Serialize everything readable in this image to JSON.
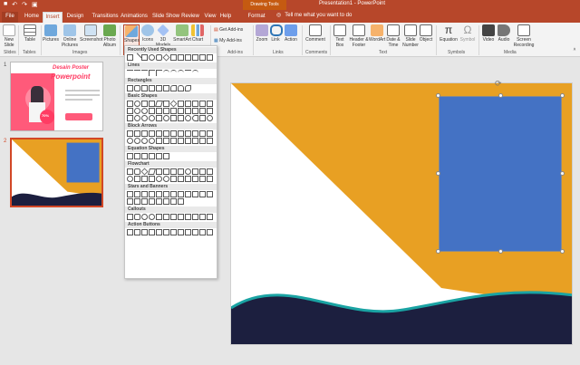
{
  "titlebar": {
    "context_group": "Drawing Tools",
    "doc_title": "Presentation1 - PowerPoint",
    "qat": [
      {
        "icon": "save-icon",
        "g": "■"
      },
      {
        "icon": "undo-icon",
        "g": "↶"
      },
      {
        "icon": "redo-icon",
        "g": "↷"
      },
      {
        "icon": "present-icon",
        "g": "▣"
      }
    ]
  },
  "tabs": [
    "File",
    "Home",
    "Insert",
    "Design",
    "Transitions",
    "Animations",
    "Slide Show",
    "Review",
    "View",
    "Help",
    "Format"
  ],
  "tell_me": "Tell me what you want to do",
  "ribbon": {
    "buttons": {
      "new_slide": "New Slide",
      "table": "Table",
      "pictures": "Pictures",
      "online_pictures": "Online Pictures",
      "screenshot": "Screenshot",
      "photo_album": "Photo Album",
      "shapes": "Shapes",
      "icons": "Icons",
      "models_3d": "3D Models",
      "smartart": "SmartArt",
      "chart": "Chart",
      "get_addins": "Get Add-ins",
      "my_addins": "My Add-ins",
      "zoom": "Zoom",
      "link": "Link",
      "action": "Action",
      "comment": "Comment",
      "text_box": "Text Box",
      "header_footer": "Header & Footer",
      "wordart": "WordArt",
      "date_time": "Date & Time",
      "slide_number": "Slide Number",
      "object": "Object",
      "equation": "Equation",
      "symbol": "Symbol",
      "video": "Video",
      "audio": "Audio",
      "screen_recording": "Screen Recording"
    },
    "groups": [
      "Slides",
      "Tables",
      "Images",
      "Add-ins",
      "Links",
      "Comments",
      "Text",
      "Symbols",
      "Media"
    ]
  },
  "slides": [
    {
      "number": "1",
      "headline1": "Desain Poster",
      "headline2": "Powerpoint",
      "badge_pct": "70%"
    },
    {
      "number": "2"
    }
  ],
  "gallery_sections": [
    "Recently Used Shapes",
    "Lines",
    "Rectangles",
    "Basic Shapes",
    "Block Arrows",
    "Equation Shapes",
    "Flowchart",
    "Stars and Banners",
    "Callouts",
    "Action Buttons"
  ],
  "colors": {
    "accent": "#b7472a",
    "orange": "#e8a023",
    "blue": "#4472c4",
    "navy": "#1c1f3f",
    "teal": "#1aa3a3",
    "pink": "#ff5a7a"
  }
}
